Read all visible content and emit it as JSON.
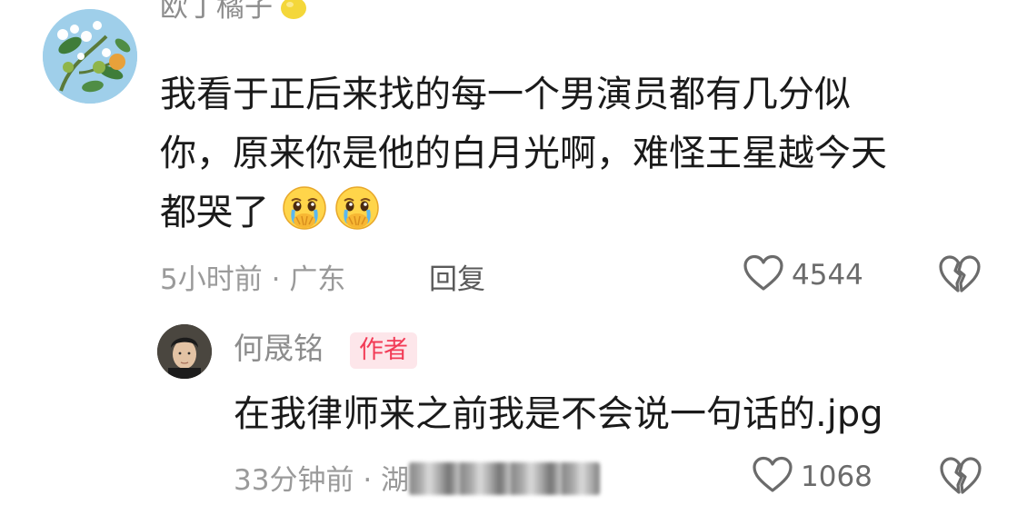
{
  "top_comment": {
    "author_name": "欧丁橘子",
    "author_emoji": "lemon-icon",
    "avatar": "orange-blossom-avatar",
    "text_lines": [
      "我看于正后来找的每一个男演员都有几分似",
      "你，原来你是他的白月光啊，难怪王星越今天",
      "都哭了"
    ],
    "trailing_emojis": [
      "crying-face-icon",
      "crying-face-icon"
    ],
    "time": "5小时前",
    "separator": "·",
    "location": "广东",
    "reply_label": "回复",
    "like_count": "4544"
  },
  "reply_comment": {
    "author_name": "何晟铭",
    "author_badge": "作者",
    "avatar": "man-portrait-avatar",
    "text": "在我律师来之前我是不会说一句话的.jpg",
    "time": "33分钟前",
    "separator": "·",
    "location_partial": "湖",
    "like_count": "1068"
  },
  "colors": {
    "text_primary": "#1a1a1a",
    "text_secondary": "#9a9a9a",
    "badge_bg": "#fde6ea",
    "badge_text": "#f23b56"
  }
}
